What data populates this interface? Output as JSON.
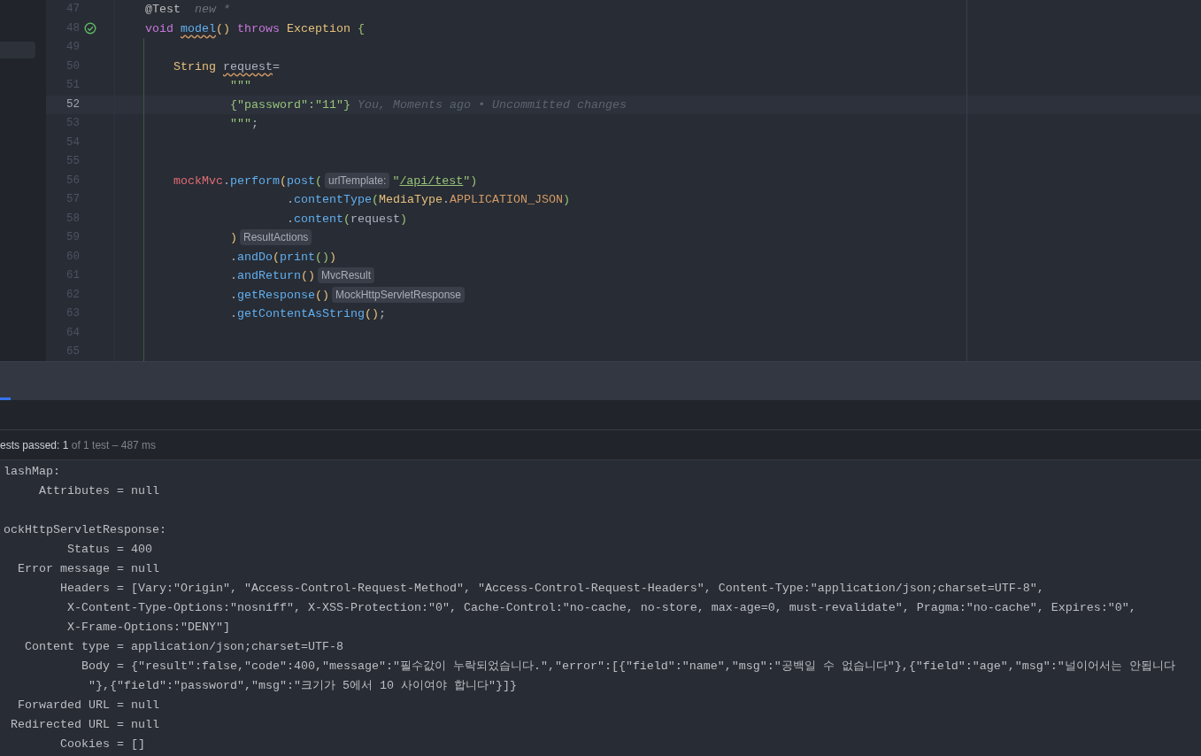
{
  "editor": {
    "lines": [
      {
        "number": "47",
        "current": false,
        "test_passed": false,
        "tokens": [
          {
            "text": "    @Test",
            "kind": "annotation"
          },
          {
            "text": "  new *",
            "kind": "author"
          }
        ]
      },
      {
        "number": "48",
        "current": false,
        "test_passed": true,
        "tokens": [
          {
            "text": "    void",
            "kind": "kw"
          },
          {
            "text": " model",
            "kind": "warnfn"
          },
          {
            "text": "()",
            "kind": "p1"
          },
          {
            "text": " throws",
            "kind": "kw"
          },
          {
            "text": " Exception",
            "kind": "type"
          },
          {
            "text": " {",
            "kind": "p2"
          }
        ]
      },
      {
        "number": "49",
        "current": false,
        "test_passed": false
      },
      {
        "number": "50",
        "current": false,
        "test_passed": false,
        "tokens": [
          {
            "text": "        String",
            "kind": "type"
          },
          {
            "text": " request",
            "kind": "warnvar"
          },
          {
            "text": "=",
            "kind": "plain"
          }
        ]
      },
      {
        "number": "51",
        "current": false,
        "test_passed": false,
        "tokens": [
          {
            "text": "                \"\"\"",
            "kind": "str"
          }
        ]
      },
      {
        "number": "52",
        "current": true,
        "test_passed": false,
        "tokens": [
          {
            "text": "                {\"password\":\"11\"}",
            "kind": "str"
          }
        ],
        "blame": "You, Moments ago • Uncommitted changes"
      },
      {
        "number": "53",
        "current": false,
        "test_passed": false,
        "tokens": [
          {
            "text": "                \"\"\"",
            "kind": "str"
          },
          {
            "text": ";",
            "kind": "plain"
          }
        ]
      },
      {
        "number": "54",
        "current": false,
        "test_passed": false
      },
      {
        "number": "55",
        "current": false,
        "test_passed": false
      },
      {
        "number": "56",
        "current": false,
        "test_passed": false,
        "tokens": [
          {
            "text": "        mockMvc",
            "kind": "field"
          },
          {
            "text": ".",
            "kind": "plain"
          },
          {
            "text": "perform",
            "kind": "fn"
          },
          {
            "text": "(",
            "kind": "p1"
          },
          {
            "text": "post",
            "kind": "fn"
          },
          {
            "text": "(",
            "kind": "p2"
          },
          {
            "text": "urlTemplate:",
            "kind": "inlay"
          },
          {
            "text": "\"",
            "kind": "str"
          },
          {
            "text": "/api/test",
            "kind": "link"
          },
          {
            "text": "\"",
            "kind": "str"
          },
          {
            "text": ")",
            "kind": "p2"
          }
        ]
      },
      {
        "number": "57",
        "current": false,
        "test_passed": false,
        "tokens": [
          {
            "text": "                        .",
            "kind": "plain"
          },
          {
            "text": "contentType",
            "kind": "fn"
          },
          {
            "text": "(",
            "kind": "p2"
          },
          {
            "text": "MediaType",
            "kind": "type"
          },
          {
            "text": ".",
            "kind": "plain"
          },
          {
            "text": "APPLICATION_JSON",
            "kind": "const"
          },
          {
            "text": ")",
            "kind": "p2"
          }
        ]
      },
      {
        "number": "58",
        "current": false,
        "test_passed": false,
        "tokens": [
          {
            "text": "                        .",
            "kind": "plain"
          },
          {
            "text": "content",
            "kind": "fn"
          },
          {
            "text": "(",
            "kind": "p2"
          },
          {
            "text": "request",
            "kind": "plain"
          },
          {
            "text": ")",
            "kind": "p2"
          }
        ]
      },
      {
        "number": "59",
        "current": false,
        "test_passed": false,
        "tokens": [
          {
            "text": "                )",
            "kind": "p1"
          },
          {
            "text": "ResultActions",
            "kind": "inlay"
          }
        ]
      },
      {
        "number": "60",
        "current": false,
        "test_passed": false,
        "tokens": [
          {
            "text": "                .",
            "kind": "plain"
          },
          {
            "text": "andDo",
            "kind": "fn"
          },
          {
            "text": "(",
            "kind": "p1"
          },
          {
            "text": "print",
            "kind": "fn"
          },
          {
            "text": "()",
            "kind": "p2"
          },
          {
            "text": ")",
            "kind": "p1"
          }
        ]
      },
      {
        "number": "61",
        "current": false,
        "test_passed": false,
        "tokens": [
          {
            "text": "                .",
            "kind": "plain"
          },
          {
            "text": "andReturn",
            "kind": "fn"
          },
          {
            "text": "()",
            "kind": "p1"
          },
          {
            "text": "MvcResult",
            "kind": "inlay"
          }
        ]
      },
      {
        "number": "62",
        "current": false,
        "test_passed": false,
        "tokens": [
          {
            "text": "                .",
            "kind": "plain"
          },
          {
            "text": "getResponse",
            "kind": "fn"
          },
          {
            "text": "()",
            "kind": "p1"
          },
          {
            "text": "MockHttpServletResponse",
            "kind": "inlay"
          }
        ]
      },
      {
        "number": "63",
        "current": false,
        "test_passed": false,
        "tokens": [
          {
            "text": "                .",
            "kind": "plain"
          },
          {
            "text": "getContentAsString",
            "kind": "fn"
          },
          {
            "text": "()",
            "kind": "p1"
          },
          {
            "text": ";",
            "kind": "plain"
          }
        ]
      },
      {
        "number": "64",
        "current": false,
        "test_passed": false
      },
      {
        "number": "65",
        "current": false,
        "test_passed": false
      }
    ]
  },
  "tool_window": {
    "tabs": [
      {
        "selected": true
      }
    ],
    "status": [
      {
        "text": "ests passed:",
        "kind": "label"
      },
      {
        "text": "1",
        "kind": "count"
      },
      {
        "text": "of 1 test – 487 ms",
        "kind": "detail"
      }
    ],
    "console": [
      {
        "lines": [
          "lashMap:",
          "     Attributes = null"
        ]
      },
      {
        "lines": [
          "ockHttpServletResponse:",
          "         Status = 400",
          "  Error message = null",
          "        Headers = [Vary:\"Origin\", \"Access-Control-Request-Method\", \"Access-Control-Request-Headers\", Content-Type:\"application/json;charset=UTF-8\",",
          "         X-Content-Type-Options:\"nosniff\", X-XSS-Protection:\"0\", Cache-Control:\"no-cache, no-store, max-age=0, must-revalidate\", Pragma:\"no-cache\", Expires:\"0\",",
          "         X-Frame-Options:\"DENY\"]",
          "   Content type = application/json;charset=UTF-8",
          "           Body = {\"result\":false,\"code\":400,\"message\":\"필수값이 누락되었습니다.\",\"error\":[{\"field\":\"name\",\"msg\":\"공백일 수 없습니다\"},{\"field\":\"age\",\"msg\":\"널이어서는 안됩니다",
          "            \"},{\"field\":\"password\",\"msg\":\"크기가 5에서 10 사이여야 합니다\"}]}",
          "  Forwarded URL = null",
          " Redirected URL = null",
          "        Cookies = []"
        ]
      }
    ]
  }
}
